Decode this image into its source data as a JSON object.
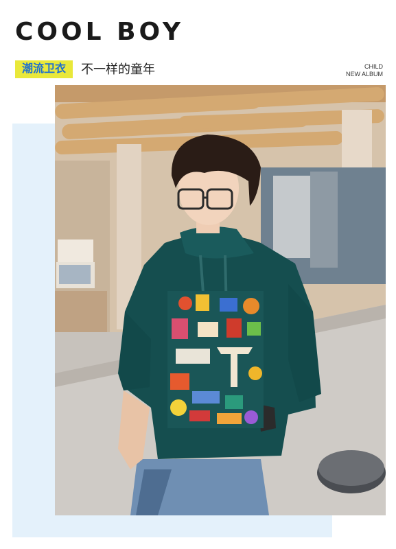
{
  "header": {
    "title": "COOL BOY",
    "tag": "潮流卫衣",
    "slogan": "不一样的童年",
    "label_line1": "CHILD",
    "label_line2": "NEW ALBUM"
  },
  "colors": {
    "tag_bg": "#e9e83a",
    "tag_text": "#1e6fd0",
    "accent_block": "#e4f1fb",
    "hoodie": "#154e4f"
  }
}
